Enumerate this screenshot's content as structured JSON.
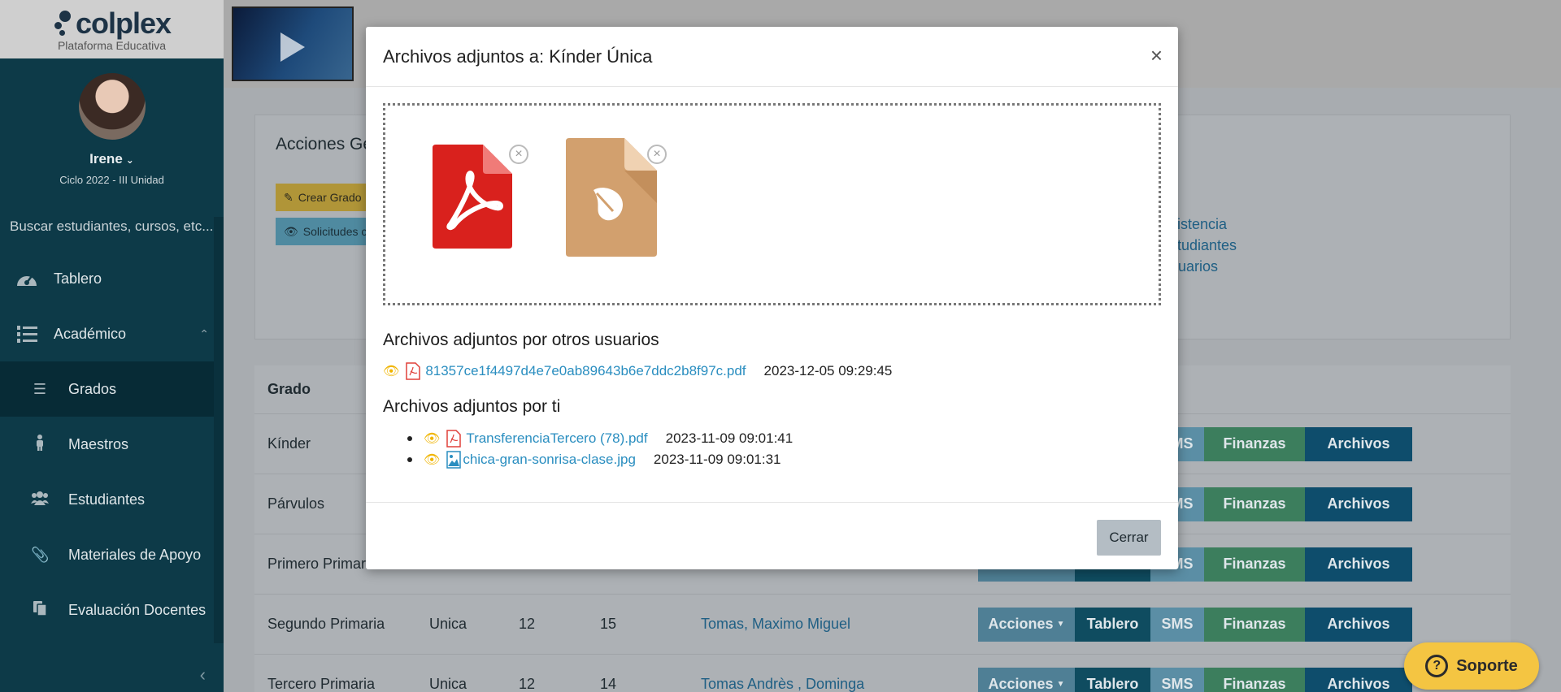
{
  "brand": {
    "name": "colplex",
    "subtitle": "Plataforma Educativa"
  },
  "user": {
    "name": "Irene",
    "cycle": "Ciclo 2022 - III Unidad"
  },
  "sidebar": {
    "search_placeholder": "Buscar estudiantes, cursos, etc...",
    "items": [
      {
        "label": "Tablero",
        "icon": "gauge-icon"
      },
      {
        "label": "Académico",
        "icon": "list-numbered-icon"
      }
    ],
    "subitems": [
      {
        "label": "Grados",
        "icon": "list-icon",
        "active": true
      },
      {
        "label": "Maestros",
        "icon": "person-icon"
      },
      {
        "label": "Estudiantes",
        "icon": "users-icon"
      },
      {
        "label": "Materiales de Apoyo",
        "icon": "paperclip-icon"
      },
      {
        "label": "Evaluación Docentes",
        "icon": "copy-icon"
      }
    ]
  },
  "background": {
    "panel_title": "Acciones Ge",
    "buttons": {
      "crear": "Crear Grado",
      "solicitudes": "Solicitudes c"
    },
    "links": [
      "Asistencia",
      "Estudiantes",
      "Usuarios"
    ],
    "table": {
      "header": {
        "grado": "Grado"
      },
      "rows": [
        {
          "grado": "Kínder",
          "seccion": "",
          "c1": "",
          "c2": "",
          "maestro": ""
        },
        {
          "grado": "Párvulos",
          "seccion": "",
          "c1": "",
          "c2": "",
          "maestro": ""
        },
        {
          "grado": "Primero Primaria",
          "seccion": "",
          "c1": "",
          "c2": "",
          "maestro": ""
        },
        {
          "grado": "Segundo Primaria",
          "seccion": "Unica",
          "c1": "12",
          "c2": "15",
          "maestro": "Tomas, Maximo Miguel"
        },
        {
          "grado": "Tercero Primaria",
          "seccion": "Unica",
          "c1": "12",
          "c2": "14",
          "maestro": "Tomas Andrès , Dominga"
        }
      ],
      "actions": {
        "acciones": "Acciones",
        "tablero": "Tablero",
        "sms": "SMS",
        "finanzas": "Finanzas",
        "archivos": "Archivos"
      }
    },
    "support_label": "Soporte"
  },
  "modal": {
    "title": "Archivos adjuntos a: Kínder Única",
    "close_symbol": "×",
    "others_title": "Archivos adjuntos por otros usuarios",
    "others_files": [
      {
        "name": "81357ce1f4497d4e7e0ab89643b6e7ddc2b8f97c.pdf",
        "date": "2023-12-05 09:29:45",
        "type": "pdf"
      }
    ],
    "mine_title": "Archivos adjuntos por ti",
    "mine_files": [
      {
        "name": "TransferenciaTercero (78).pdf",
        "date": "2023-11-09 09:01:41",
        "type": "pdf"
      },
      {
        "name": "chica-gran-sonrisa-clase.jpg",
        "date": "2023-11-09 09:01:31",
        "type": "image"
      }
    ],
    "close_button": "Cerrar"
  },
  "colors": {
    "sidebar": "#0d3a48",
    "link": "#2a8ec0",
    "pdf_red": "#d9211d",
    "file_tan": "#d2a06e",
    "eye": "#f0b400"
  }
}
